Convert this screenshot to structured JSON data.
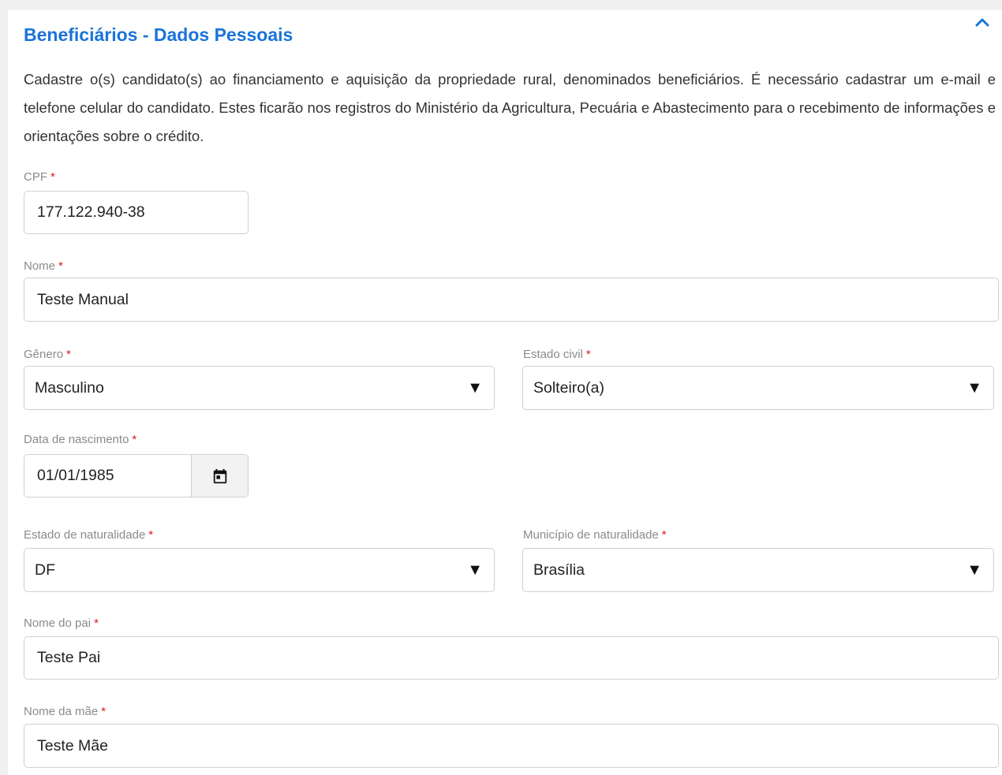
{
  "section": {
    "title": "Beneficiários - Dados Pessoais",
    "description": "Cadastre o(s) candidato(s) ao financiamento e aquisição da propriedade rural, denominados beneficiários. É necessário cadastrar um e-mail e telefone celular do candidato. Estes ficarão nos registros do Ministério da Agricultura, Pecuária e Abastecimento para o recebimento de informações e orientações sobre o crédito.",
    "collapse_icon": "chevron-up-icon"
  },
  "required_marker": "*",
  "colors": {
    "accent": "#1a73d9",
    "required": "#e0161e",
    "label": "#8a8a8a",
    "border": "#d0d0d0"
  },
  "fields": {
    "cpf": {
      "label": "CPF",
      "value": "177.122.940-38"
    },
    "nome": {
      "label": "Nome",
      "value": "Teste Manual"
    },
    "genero": {
      "label": "Gênero",
      "value": "Masculino"
    },
    "estado_civil": {
      "label": "Estado civil",
      "value": "Solteiro(a)"
    },
    "data_nascimento": {
      "label": "Data de nascimento",
      "value": "01/01/1985",
      "icon": "calendar-icon"
    },
    "estado_naturalidade": {
      "label": "Estado de naturalidade",
      "value": "DF"
    },
    "municipio_naturalidade": {
      "label": "Município de naturalidade",
      "value": "Brasília"
    },
    "nome_pai": {
      "label": "Nome do pai",
      "value": "Teste Pai"
    },
    "nome_mae": {
      "label": "Nome da mãe",
      "value": "Teste Mãe"
    }
  },
  "dropdown_icon": "▼"
}
